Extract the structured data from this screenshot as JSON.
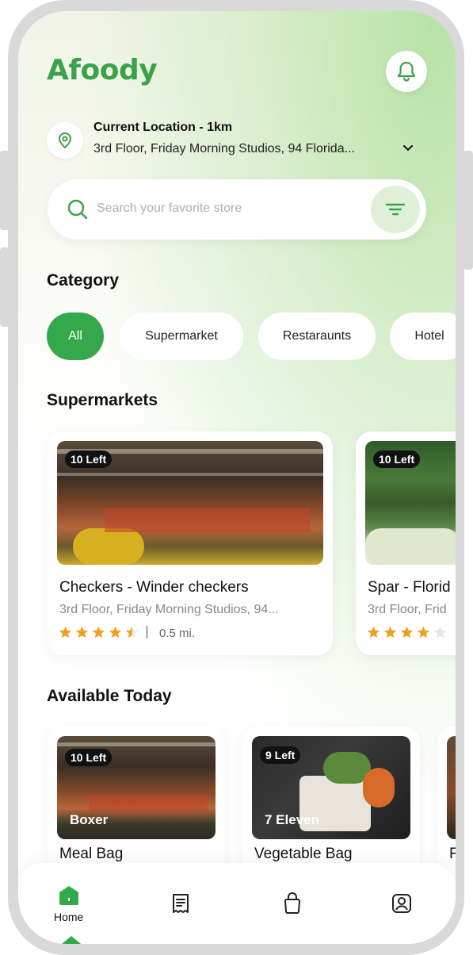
{
  "app": {
    "logo": "Afoody",
    "accent": "#34a94b"
  },
  "header": {
    "bell_icon": "bell-icon"
  },
  "location": {
    "title": "Current Location - 1km",
    "address": "3rd Floor, Friday Morning Studios, 94 Florida..."
  },
  "search": {
    "placeholder": "Search your favorite store"
  },
  "category": {
    "title": "Category",
    "chips": [
      "All",
      "Supermarket",
      "Restaraunts",
      "Hotel"
    ]
  },
  "supermarkets": {
    "title": "Supermarkets",
    "cards": [
      {
        "badge": "10 Left",
        "name": "Checkers - Winder checkers",
        "address": "3rd Floor, Friday Morning Studios, 94...",
        "rating": 4.5,
        "distance": "0.5 mi."
      },
      {
        "badge": "10 Left",
        "name": "Spar - Florid",
        "address": "3rd Floor, Frid",
        "rating": 4
      }
    ]
  },
  "available_today": {
    "title": "Available Today",
    "cards": [
      {
        "badge": "10 Left",
        "store": "Boxer",
        "name": "Meal Bag"
      },
      {
        "badge": "9 Left",
        "store": "7 Eleven",
        "name": "Vegetable Bag"
      },
      {
        "name": "F"
      }
    ]
  },
  "nav": {
    "home_label": "Home"
  }
}
